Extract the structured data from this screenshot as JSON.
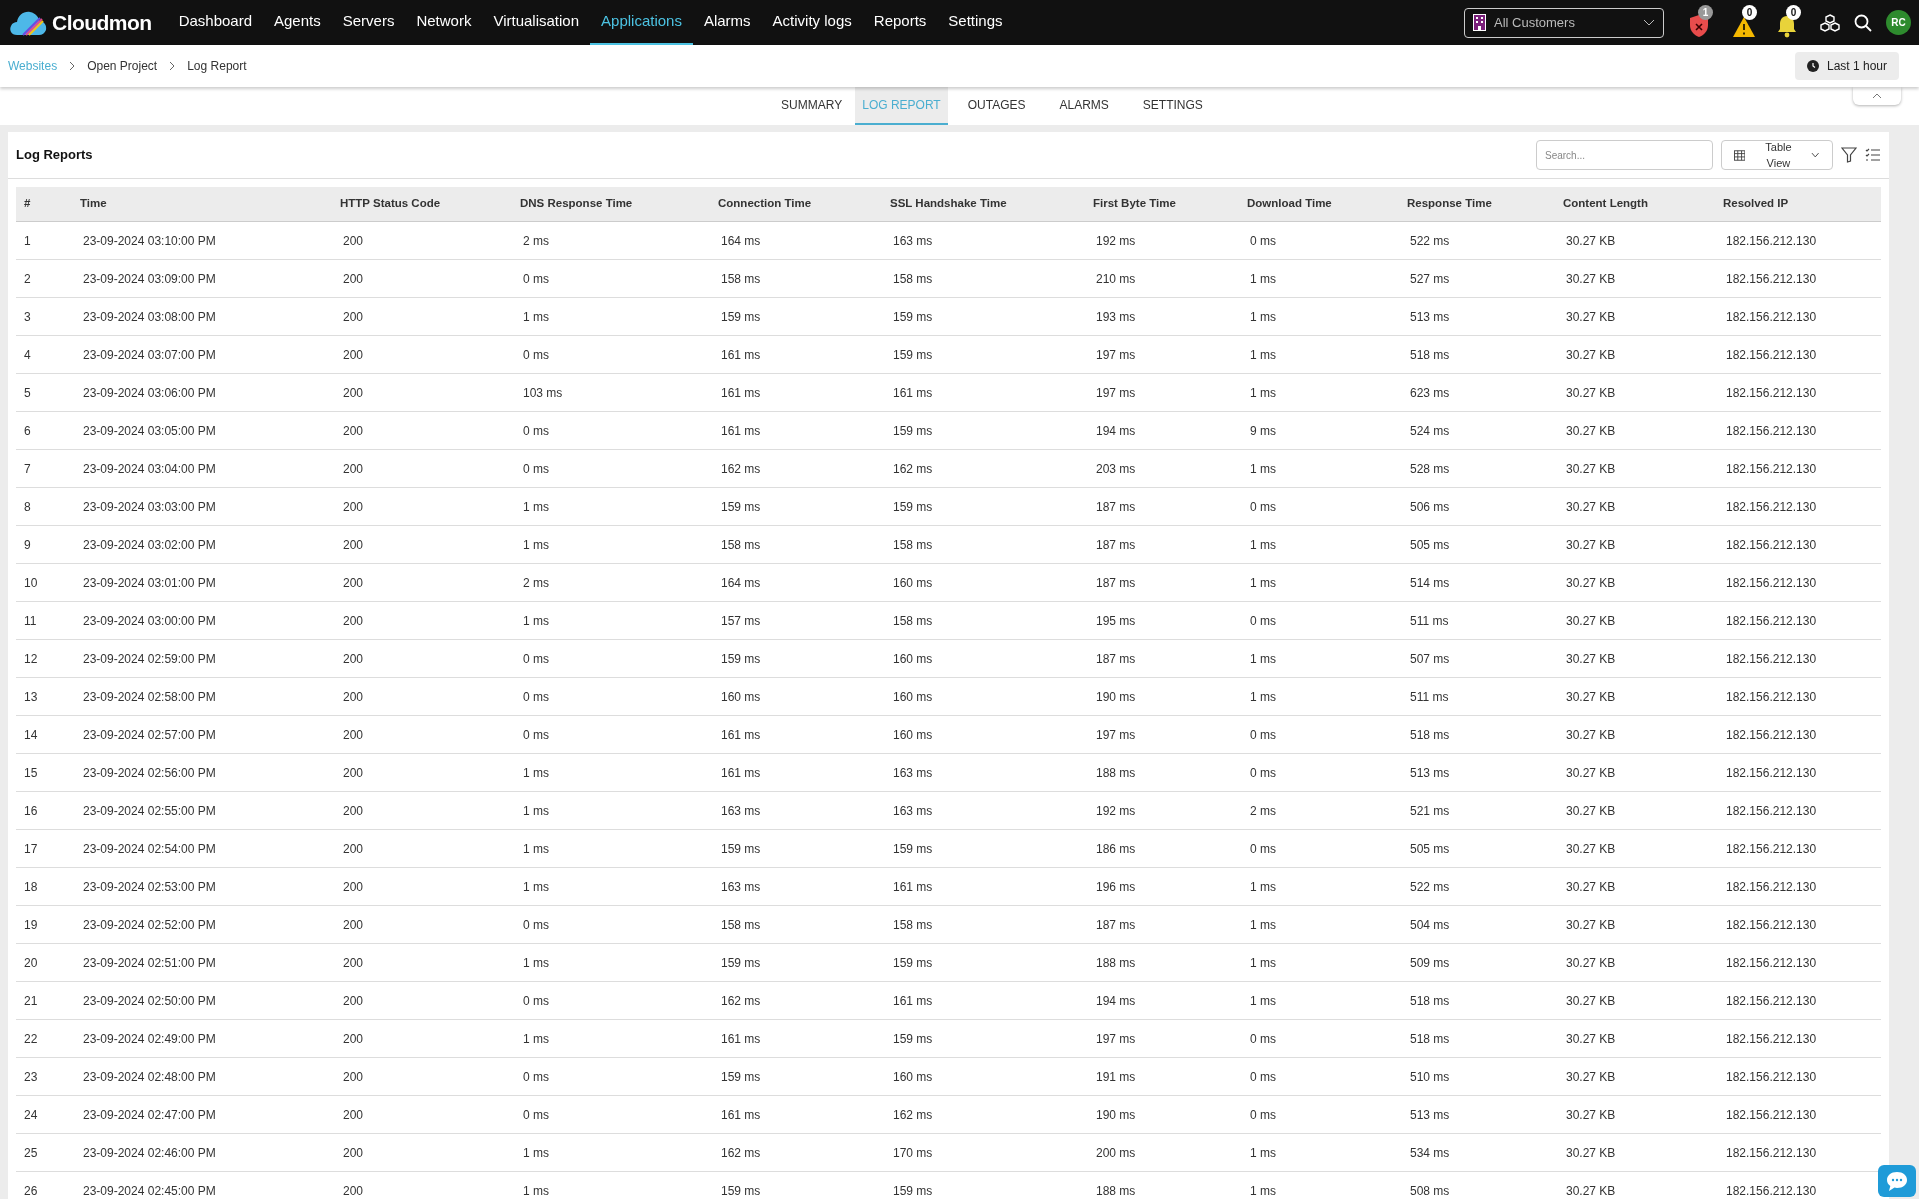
{
  "brand": {
    "name": "Cloudmon"
  },
  "nav": [
    {
      "label": "Dashboard",
      "selected": false
    },
    {
      "label": "Agents",
      "selected": false
    },
    {
      "label": "Servers",
      "selected": false
    },
    {
      "label": "Network",
      "selected": false
    },
    {
      "label": "Virtualisation",
      "selected": false
    },
    {
      "label": "Applications",
      "selected": true
    },
    {
      "label": "Alarms",
      "selected": false
    },
    {
      "label": "Activity logs",
      "selected": false
    },
    {
      "label": "Reports",
      "selected": false
    },
    {
      "label": "Settings",
      "selected": false
    }
  ],
  "customer_select": {
    "value": "All Customers"
  },
  "alerts": [
    {
      "kind": "shield",
      "count": "1"
    },
    {
      "kind": "warning",
      "count": "0"
    },
    {
      "kind": "bell",
      "count": "0"
    }
  ],
  "avatar": {
    "initials": "RC"
  },
  "breadcrumbs": [
    "Websites",
    "Open Project",
    "Log Report"
  ],
  "time_range": "Last 1 hour",
  "tabs": [
    {
      "label": "SUMMARY",
      "selected": false
    },
    {
      "label": "LOG REPORT",
      "selected": true
    },
    {
      "label": "OUTAGES",
      "selected": false
    },
    {
      "label": "ALARMS",
      "selected": false
    },
    {
      "label": "SETTINGS",
      "selected": false
    }
  ],
  "card": {
    "title": "Log Reports",
    "search": {
      "placeholder": "Search..."
    },
    "view_select": "Table View"
  },
  "table": {
    "columns": [
      "#",
      "Time",
      "HTTP Status Code",
      "DNS Response Time",
      "Connection Time",
      "SSL Handshake Time",
      "First Byte Time",
      "Download Time",
      "Response Time",
      "Content Length",
      "Resolved IP"
    ],
    "rows": [
      [
        "1",
        "23-09-2024 03:10:00 PM",
        "200",
        "2 ms",
        "164 ms",
        "163 ms",
        "192 ms",
        "0 ms",
        "522 ms",
        "30.27 KB",
        "182.156.212.130"
      ],
      [
        "2",
        "23-09-2024 03:09:00 PM",
        "200",
        "0 ms",
        "158 ms",
        "158 ms",
        "210 ms",
        "1 ms",
        "527 ms",
        "30.27 KB",
        "182.156.212.130"
      ],
      [
        "3",
        "23-09-2024 03:08:00 PM",
        "200",
        "1 ms",
        "159 ms",
        "159 ms",
        "193 ms",
        "1 ms",
        "513 ms",
        "30.27 KB",
        "182.156.212.130"
      ],
      [
        "4",
        "23-09-2024 03:07:00 PM",
        "200",
        "0 ms",
        "161 ms",
        "159 ms",
        "197 ms",
        "1 ms",
        "518 ms",
        "30.27 KB",
        "182.156.212.130"
      ],
      [
        "5",
        "23-09-2024 03:06:00 PM",
        "200",
        "103 ms",
        "161 ms",
        "161 ms",
        "197 ms",
        "1 ms",
        "623 ms",
        "30.27 KB",
        "182.156.212.130"
      ],
      [
        "6",
        "23-09-2024 03:05:00 PM",
        "200",
        "0 ms",
        "161 ms",
        "159 ms",
        "194 ms",
        "9 ms",
        "524 ms",
        "30.27 KB",
        "182.156.212.130"
      ],
      [
        "7",
        "23-09-2024 03:04:00 PM",
        "200",
        "0 ms",
        "162 ms",
        "162 ms",
        "203 ms",
        "1 ms",
        "528 ms",
        "30.27 KB",
        "182.156.212.130"
      ],
      [
        "8",
        "23-09-2024 03:03:00 PM",
        "200",
        "1 ms",
        "159 ms",
        "159 ms",
        "187 ms",
        "0 ms",
        "506 ms",
        "30.27 KB",
        "182.156.212.130"
      ],
      [
        "9",
        "23-09-2024 03:02:00 PM",
        "200",
        "1 ms",
        "158 ms",
        "158 ms",
        "187 ms",
        "1 ms",
        "505 ms",
        "30.27 KB",
        "182.156.212.130"
      ],
      [
        "10",
        "23-09-2024 03:01:00 PM",
        "200",
        "2 ms",
        "164 ms",
        "160 ms",
        "187 ms",
        "1 ms",
        "514 ms",
        "30.27 KB",
        "182.156.212.130"
      ],
      [
        "11",
        "23-09-2024 03:00:00 PM",
        "200",
        "1 ms",
        "157 ms",
        "158 ms",
        "195 ms",
        "0 ms",
        "511 ms",
        "30.27 KB",
        "182.156.212.130"
      ],
      [
        "12",
        "23-09-2024 02:59:00 PM",
        "200",
        "0 ms",
        "159 ms",
        "160 ms",
        "187 ms",
        "1 ms",
        "507 ms",
        "30.27 KB",
        "182.156.212.130"
      ],
      [
        "13",
        "23-09-2024 02:58:00 PM",
        "200",
        "0 ms",
        "160 ms",
        "160 ms",
        "190 ms",
        "1 ms",
        "511 ms",
        "30.27 KB",
        "182.156.212.130"
      ],
      [
        "14",
        "23-09-2024 02:57:00 PM",
        "200",
        "0 ms",
        "161 ms",
        "160 ms",
        "197 ms",
        "0 ms",
        "518 ms",
        "30.27 KB",
        "182.156.212.130"
      ],
      [
        "15",
        "23-09-2024 02:56:00 PM",
        "200",
        "1 ms",
        "161 ms",
        "163 ms",
        "188 ms",
        "0 ms",
        "513 ms",
        "30.27 KB",
        "182.156.212.130"
      ],
      [
        "16",
        "23-09-2024 02:55:00 PM",
        "200",
        "1 ms",
        "163 ms",
        "163 ms",
        "192 ms",
        "2 ms",
        "521 ms",
        "30.27 KB",
        "182.156.212.130"
      ],
      [
        "17",
        "23-09-2024 02:54:00 PM",
        "200",
        "1 ms",
        "159 ms",
        "159 ms",
        "186 ms",
        "0 ms",
        "505 ms",
        "30.27 KB",
        "182.156.212.130"
      ],
      [
        "18",
        "23-09-2024 02:53:00 PM",
        "200",
        "1 ms",
        "163 ms",
        "161 ms",
        "196 ms",
        "1 ms",
        "522 ms",
        "30.27 KB",
        "182.156.212.130"
      ],
      [
        "19",
        "23-09-2024 02:52:00 PM",
        "200",
        "0 ms",
        "158 ms",
        "158 ms",
        "187 ms",
        "1 ms",
        "504 ms",
        "30.27 KB",
        "182.156.212.130"
      ],
      [
        "20",
        "23-09-2024 02:51:00 PM",
        "200",
        "1 ms",
        "159 ms",
        "159 ms",
        "188 ms",
        "1 ms",
        "509 ms",
        "30.27 KB",
        "182.156.212.130"
      ],
      [
        "21",
        "23-09-2024 02:50:00 PM",
        "200",
        "0 ms",
        "162 ms",
        "161 ms",
        "194 ms",
        "1 ms",
        "518 ms",
        "30.27 KB",
        "182.156.212.130"
      ],
      [
        "22",
        "23-09-2024 02:49:00 PM",
        "200",
        "1 ms",
        "161 ms",
        "159 ms",
        "197 ms",
        "0 ms",
        "518 ms",
        "30.27 KB",
        "182.156.212.130"
      ],
      [
        "23",
        "23-09-2024 02:48:00 PM",
        "200",
        "0 ms",
        "159 ms",
        "160 ms",
        "191 ms",
        "0 ms",
        "510 ms",
        "30.27 KB",
        "182.156.212.130"
      ],
      [
        "24",
        "23-09-2024 02:47:00 PM",
        "200",
        "0 ms",
        "161 ms",
        "162 ms",
        "190 ms",
        "0 ms",
        "513 ms",
        "30.27 KB",
        "182.156.212.130"
      ],
      [
        "25",
        "23-09-2024 02:46:00 PM",
        "200",
        "1 ms",
        "162 ms",
        "170 ms",
        "200 ms",
        "1 ms",
        "534 ms",
        "30.27 KB",
        "182.156.212.130"
      ],
      [
        "26",
        "23-09-2024 02:45:00 PM",
        "200",
        "1 ms",
        "159 ms",
        "159 ms",
        "188 ms",
        "1 ms",
        "508 ms",
        "30.27 KB",
        "182.156.212.130"
      ]
    ]
  }
}
